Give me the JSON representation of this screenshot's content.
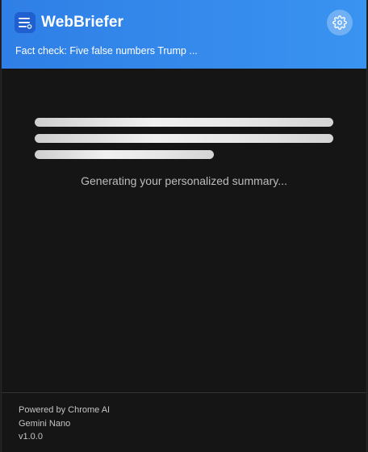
{
  "app": {
    "title": "WebBriefer"
  },
  "header": {
    "page_title": "Fact check: Five false numbers Trump ...",
    "settings_icon": "gear-icon",
    "menu_icon": "menu-lines-icon",
    "accent_color": "#3a8ef0"
  },
  "main": {
    "loading_text": "Generating your personalized summary...",
    "skeleton_lines": 3
  },
  "footer": {
    "powered_by": "Powered by Chrome AI",
    "model": "Gemini Nano",
    "version": "v1.0.0"
  }
}
